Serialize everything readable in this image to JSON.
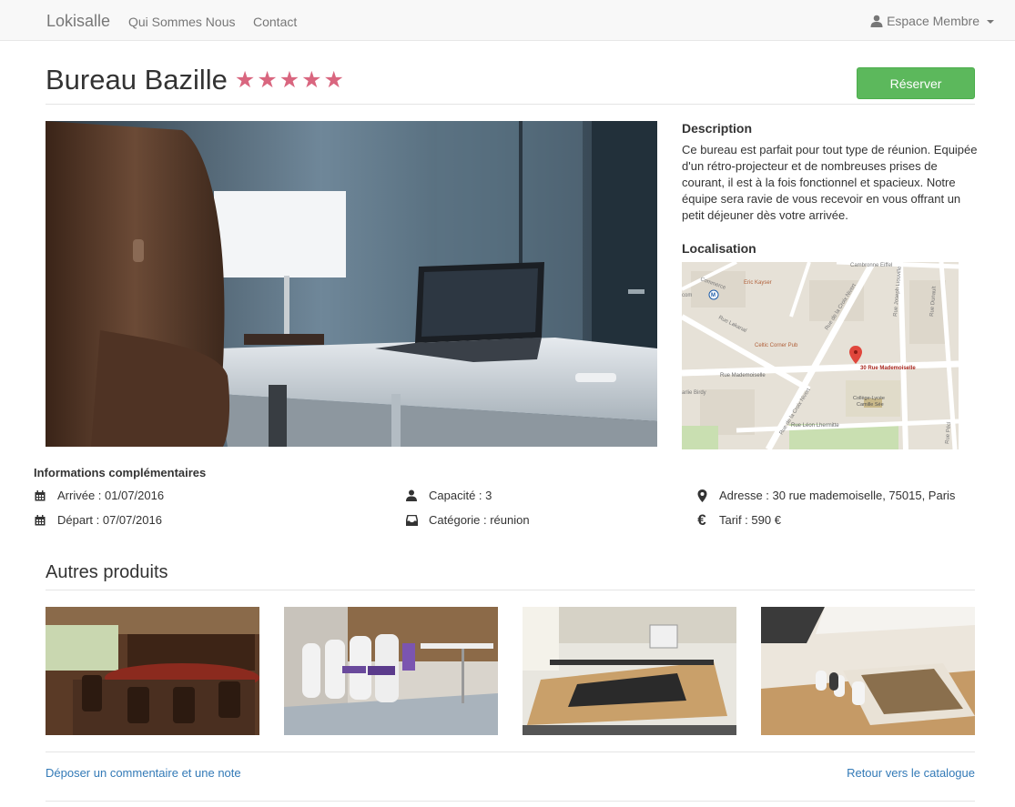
{
  "navbar": {
    "brand": "Lokisalle",
    "links": [
      "Qui Sommes Nous",
      "Contact"
    ],
    "member_label": "Espace Membre"
  },
  "product": {
    "title": "Bureau Bazille",
    "rating": 5,
    "rating_stars": "★★★★★",
    "reserve_label": "Réserver"
  },
  "description": {
    "heading": "Description",
    "text": "Ce bureau est parfait pour tout type de réunion. Equipée d'un rétro-projecteur et de nombreuses prises de courant, il est à la fois fonctionnel et spacieux. Notre équipe sera ravie de vous recevoir en vous offrant un petit déjeuner dès votre arrivée."
  },
  "location": {
    "heading": "Localisation",
    "map_labels": {
      "marker": "30 Rue Mademoiselle",
      "street_1": "Rue Mademoiselle",
      "street_2": "Rue de la Croix Nivert",
      "street_3": "Rue Léon Lhermitte",
      "street_4": "Rue Lakanal",
      "street_5": "Rue Joseph Liouville",
      "street_6": "Rue Dunault",
      "street_7": "Cambronne Eiffel",
      "poi_1": "Eric Kayser",
      "poi_2": "Celtic Corner Pub",
      "poi_3": "Collège-Lycée Camille Sée",
      "poi_4": "arlie Birdy",
      "poi_5": "Commerce",
      "poi_6": "Rue Pécl"
    }
  },
  "info": {
    "heading": "Informations complémentaires",
    "arrival": "Arrivée : 01/07/2016",
    "departure": "Départ : 07/07/2016",
    "capacity": "Capacité : 3",
    "category": "Catégorie : réunion",
    "address": "Adresse : 30 rue mademoiselle, 75015, Paris",
    "price": "Tarif : 590 €",
    "euro_symbol": "€"
  },
  "others": {
    "heading": "Autres produits"
  },
  "footer": {
    "comment_link": "Déposer un commentaire et une note",
    "catalog_link": "Retour vers le catalogue"
  },
  "icons": {
    "user": "user-icon",
    "calendar": "calendar-icon",
    "inbox": "inbox-icon",
    "marker": "map-marker-icon",
    "euro": "euro-icon"
  },
  "colors": {
    "accent_green": "#5cb85c",
    "star_pink": "#d9667f",
    "link_blue": "#337ab7"
  }
}
